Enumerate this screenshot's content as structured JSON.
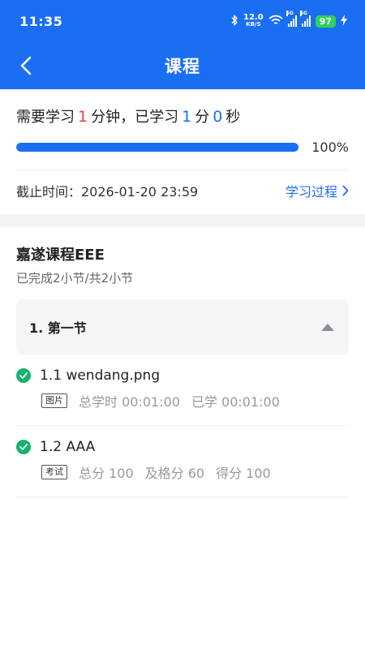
{
  "status_bar": {
    "time": "11:35",
    "net_speed_value": "12.0",
    "net_speed_unit": "KB/S",
    "signal1_tag": "5G",
    "signal2_tag": "5G",
    "battery": "97"
  },
  "nav": {
    "title": "课程"
  },
  "progress": {
    "required_prefix": "需要学习",
    "required_minutes": "1",
    "required_unit": "分钟，已学习",
    "studied_minutes": "1",
    "minute_unit": "分",
    "studied_seconds": "0",
    "second_unit": "秒",
    "percent": "100%",
    "fill_fraction": 1.0,
    "deadline": "截止时间：2026-01-20 23:59",
    "process_link": "学习过程"
  },
  "course": {
    "title": "嘉遂课程EEE",
    "subtitle": "已完成2小节/共2小节",
    "section_label": "1. 第一节",
    "lessons": [
      {
        "title": "1.1 wendang.png",
        "badge": "图片",
        "meta1": "总学时 00:01:00",
        "meta2": "已学 00:01:00",
        "meta3": ""
      },
      {
        "title": "1.2 AAA",
        "badge": "考试",
        "meta1": "总分 100",
        "meta2": "及格分 60",
        "meta3": "得分 100"
      }
    ]
  },
  "colors": {
    "brand": "#1a6ef2",
    "required_highlight": "#e64340",
    "complete": "#14b46a"
  }
}
